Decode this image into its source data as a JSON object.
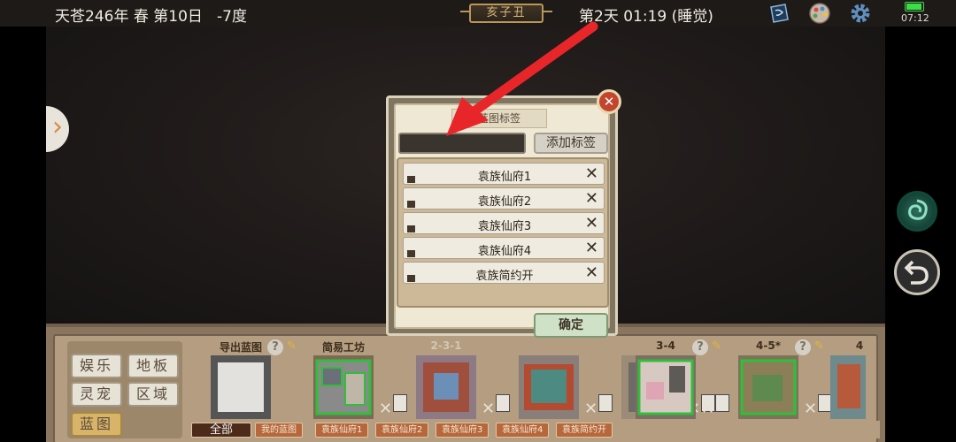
{
  "status_bar": {
    "date": "天苍246年 春 第10日",
    "temperature": "-7度",
    "ganzhi": "亥子丑",
    "daytime": "第2天 01:19 (睡觉)",
    "clock": "07:12"
  },
  "categories": {
    "items": [
      "娱乐",
      "地板",
      "灵宠",
      "区域",
      "蓝图"
    ],
    "active": "蓝图"
  },
  "blueprints": [
    {
      "title": "导出蓝图"
    },
    {
      "title": "简易工坊"
    },
    {
      "title": "2-3-1"
    },
    {
      "title": ""
    },
    {
      "title": ""
    },
    {
      "title": "3-4"
    },
    {
      "title": "4-5*"
    },
    {
      "title": "4"
    }
  ],
  "blueprint_tags": [
    "全部",
    "我的蓝图",
    "袁族仙府1",
    "袁族仙府2",
    "袁族仙府3",
    "袁族仙府4",
    "袁族简约开"
  ],
  "modal": {
    "title": "蓝图标签",
    "input_value": "",
    "add_label": "添加标签",
    "tags": [
      "袁族仙府1",
      "袁族仙府2",
      "袁族仙府3",
      "袁族仙府4",
      "袁族简约开"
    ],
    "confirm_label": "确定",
    "close_symbol": "✕"
  },
  "colors": {
    "annotation_arrow": "#e8262a",
    "confirm_bg": "#cfe2c7",
    "close_bg": "#c2452e"
  }
}
